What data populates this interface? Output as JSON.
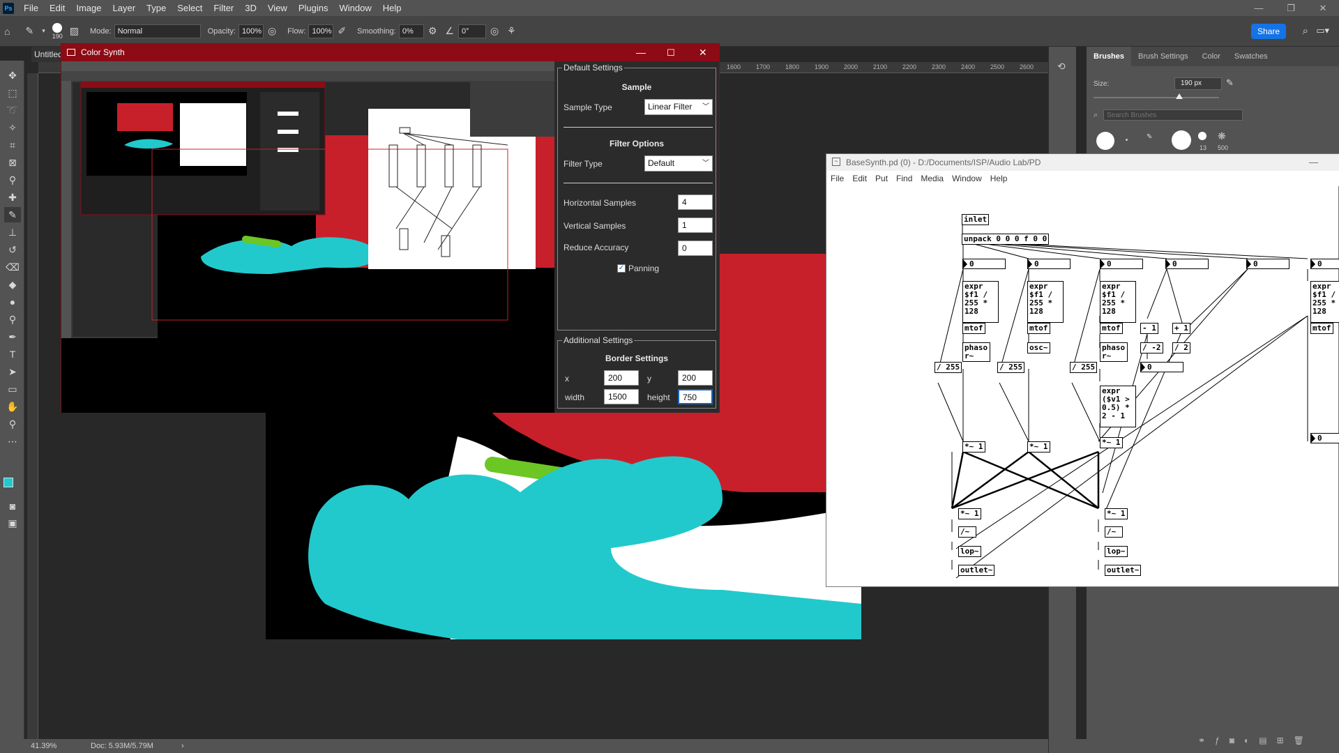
{
  "menubar": {
    "logo": "Ps",
    "items": [
      "File",
      "Edit",
      "Image",
      "Layer",
      "Type",
      "Select",
      "Filter",
      "3D",
      "View",
      "Plugins",
      "Window",
      "Help"
    ]
  },
  "options": {
    "brush_size": "190",
    "mode_label": "Mode:",
    "mode_value": "Normal",
    "opacity_label": "Opacity:",
    "opacity_value": "100%",
    "flow_label": "Flow:",
    "flow_value": "100%",
    "smoothing_label": "Smoothing:",
    "smoothing_value": "0%",
    "angle_value": "0°",
    "share_label": "Share"
  },
  "document": {
    "tab_title": "Untitled",
    "zoom": "41.39%",
    "doc_info": "Doc: 5.93M/5.79M",
    "ruler_ticks": [
      "1600",
      "1700",
      "1800",
      "1900",
      "2000",
      "2100",
      "2200",
      "2300",
      "2400",
      "2500",
      "2600"
    ]
  },
  "brushes_panel": {
    "tabs": [
      "Brushes",
      "Brush Settings",
      "Color",
      "Swatches"
    ],
    "size_label": "Size:",
    "size_value": "190 px",
    "search_placeholder": "Search Brushes",
    "preset_labels": [
      "13",
      "500"
    ]
  },
  "color_synth": {
    "title": "Color Synth",
    "default_settings": {
      "group_title": "Default Settings",
      "sample_title": "Sample",
      "sample_type_label": "Sample Type",
      "sample_type_value": "Linear Filter",
      "filter_title": "Filter Options",
      "filter_type_label": "Filter Type",
      "filter_type_value": "Default",
      "h_samples_label": "Horizontal Samples",
      "h_samples_value": "4",
      "v_samples_label": "Vertical Samples",
      "v_samples_value": "1",
      "reduce_label": "Reduce Accuracy",
      "reduce_value": "0",
      "panning_label": "Panning",
      "panning_checked": true
    },
    "additional_settings": {
      "group_title": "Additional Settings",
      "border_title": "Border Settings",
      "x_label": "x",
      "x_value": "200",
      "y_label": "y",
      "y_value": "200",
      "width_label": "width",
      "width_value": "1500",
      "height_label": "height",
      "height_value": "750"
    }
  },
  "pd": {
    "title": "BaseSynth.pd  (0) - D:/Documents/ISP/Audio Lab/PD",
    "menu": [
      "File",
      "Edit",
      "Put",
      "Find",
      "Media",
      "Window",
      "Help"
    ],
    "objects": {
      "inlet": "inlet",
      "unpack": "unpack 0 0 0 f 0 0",
      "expr": "expr\n$f1 /\n255 *\n128",
      "mtof": "mtof",
      "phasor": "phaso\nr~",
      "osc": "osc~",
      "div255": "/ 255",
      "expr_sq": "expr\n($v1 >\n0.5) *\n2 - 1",
      "mult": "*~ 1",
      "minus1": "- 1",
      "plus1": "+ 1",
      "divneg2": "/ -2",
      "div2": "/ 2",
      "divtilde": "/~",
      "lop": "lop~",
      "outlet": "outlet~",
      "num0": "0"
    }
  },
  "colors": {
    "accent_red": "#c8202a",
    "teal": "#22c9cc",
    "lime": "#6cc624",
    "titlebar_red": "#8c0b14",
    "share_blue": "#1473e6"
  }
}
